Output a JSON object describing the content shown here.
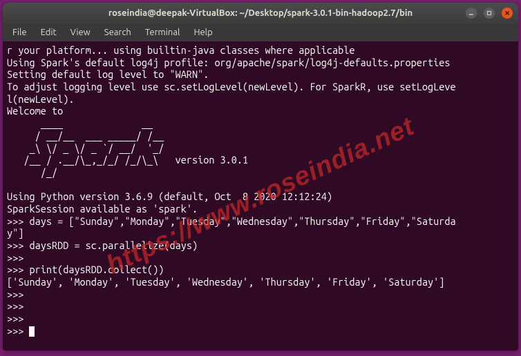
{
  "titlebar": {
    "title": "roseindia@deepak-VirtualBox: ~/Desktop/spark-3.0.1-bin-hadoop2.7/bin"
  },
  "menubar": {
    "items": [
      "File",
      "Edit",
      "View",
      "Search",
      "Terminal",
      "Help"
    ]
  },
  "terminal": {
    "lines": [
      "r your platform... using builtin-java classes where applicable",
      "Using Spark's default log4j profile: org/apache/spark/log4j-defaults.properties",
      "Setting default log level to \"WARN\".",
      "To adjust logging level use sc.setLogLevel(newLevel). For SparkR, use setLogLeve",
      "l(newLevel).",
      "Welcome to",
      "      ____              __",
      "     / __/__  ___ _____/ /__",
      "    _\\ \\/ _ \\/ _ `/ __/  '_/",
      "   /__ / .__/\\_,_/_/ /_/\\_\\   version 3.0.1",
      "      /_/",
      "",
      "Using Python version 3.6.9 (default, Oct  8 2020 12:12:24)",
      "SparkSession available as 'spark'.",
      ">>> days = [\"Sunday\",\"Monday\",\"Tuesday\",\"Wednesday\",\"Thursday\",\"Friday\",\"Saturda",
      "y\"]",
      ">>> daysRDD = sc.parallelize(days)",
      ">>> ",
      ">>> print(daysRDD.collect())",
      "['Sunday', 'Monday', 'Tuesday', 'Wednesday', 'Thursday', 'Friday', 'Saturday']",
      ">>> ",
      ">>> ",
      ">>> ",
      ">>> "
    ]
  },
  "watermark": {
    "text": "https://www.roseindia.net"
  }
}
